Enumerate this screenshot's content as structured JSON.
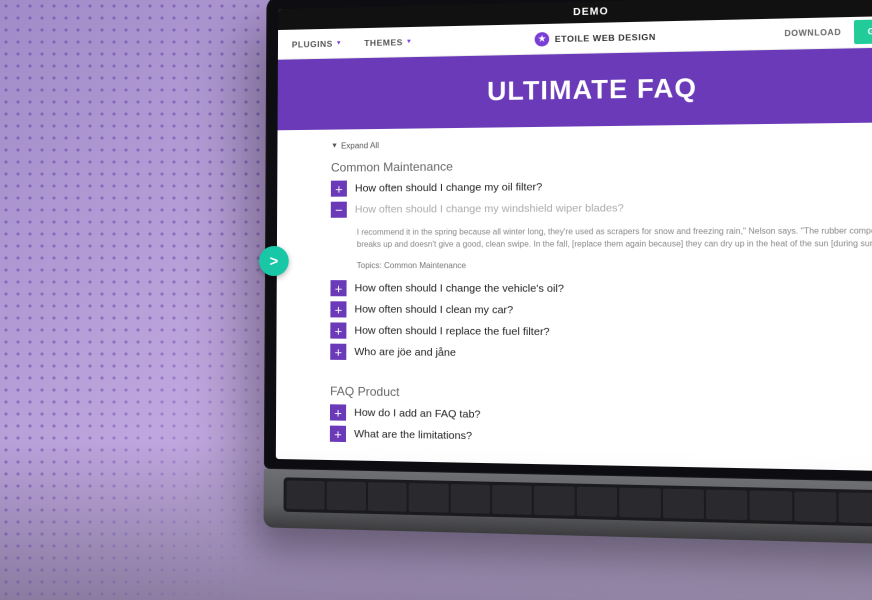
{
  "demo_bar": "DEMO",
  "nav": {
    "plugins": "PLUGINS",
    "themes": "THEMES",
    "brand": "ETOILE WEB DESIGN",
    "download": "DOWNLOAD",
    "get_premium": "GET PRE"
  },
  "hero": {
    "title": "ULTIMATE FAQ"
  },
  "expand_all": "Expand All",
  "sections": [
    {
      "title": "Common Maintenance",
      "items": [
        {
          "q": "How often should I change my oil filter?",
          "expanded": false
        },
        {
          "q": "How often should I change my windshield wiper blades?",
          "expanded": true,
          "answer": "I recommend it in the spring because all winter long, they're used as scrapers for snow and freezing rain,\" Nelson says. \"The rubber compound breaks up and doesn't give a good, clean swipe. In the fall, [replace them again because] they can dry up in the heat of the sun [during summer].",
          "topics_label": "Topics:",
          "topics": "Common Maintenance"
        },
        {
          "q": "How often should I change the vehicle's oil?",
          "expanded": false
        },
        {
          "q": "How often should I clean my car?",
          "expanded": false
        },
        {
          "q": "How often should I replace the fuel filter?",
          "expanded": false
        },
        {
          "q": "Who are jöe and jåne",
          "expanded": false
        }
      ]
    },
    {
      "title": "FAQ Product",
      "items": [
        {
          "q": "How do I add an FAQ tab?",
          "expanded": false
        },
        {
          "q": "What are the limitations?",
          "expanded": false
        }
      ]
    }
  ],
  "icons": {
    "plus": "+",
    "minus": "−",
    "star": "★",
    "caret_down": "▼",
    "play": ">"
  }
}
